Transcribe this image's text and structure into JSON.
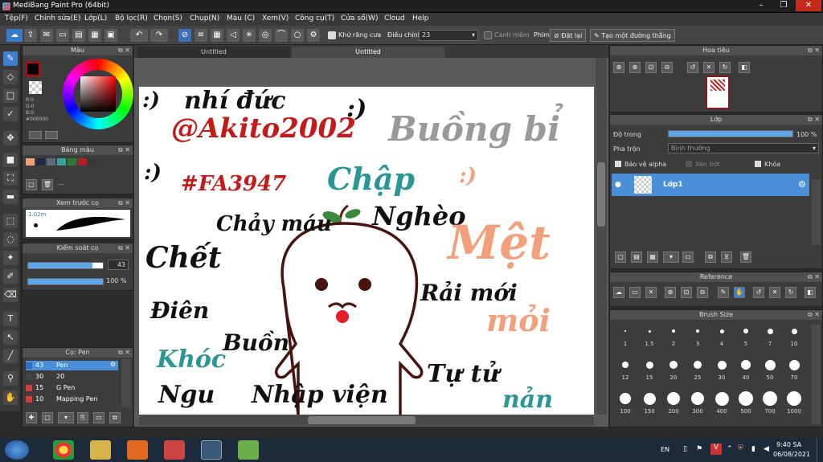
{
  "window": {
    "title": "MediBang Paint Pro (64bit)",
    "min": "–",
    "max": "❐",
    "close": "✕"
  },
  "menu": [
    "Tệp(F)",
    "Chỉnh sửa(E)",
    "Lớp(L)",
    "Bộ lọc(R)",
    "Chọn(S)",
    "Chụp(N)",
    "Màu (C)",
    "Xem(V)",
    "Công cụ(T)",
    "Cửa sổ(W)",
    "Cloud",
    "Help"
  ],
  "toolbar": {
    "antialias_label": "Khử răng cưa",
    "correction_label": "Điều chỉnh",
    "correction_value": "23",
    "canh_mem_label": "Canh mềm",
    "phim_label": "Phim",
    "undo_label": "Đặt lại",
    "straight_label": "Tạo một đường thẳng"
  },
  "tabs": {
    "left": "Untitled",
    "right": "Untitled"
  },
  "color_panel": {
    "title": "Màu",
    "r": "R:0",
    "g": "G:0",
    "b": "B:0",
    "hex": "#000000"
  },
  "palette_panel": {
    "title": "Bảng màu",
    "dash": "---",
    "colors": [
      "#f2a07a",
      "#1e2a4a",
      "#5a6a7a",
      "#3aa0a0",
      "#2c7a3a",
      "#b02020",
      "#383838"
    ]
  },
  "brush_preview": {
    "title": "Xem trước cọ",
    "size": "1.02m"
  },
  "brush_control": {
    "title": "Kiểm soát cọ",
    "size": "43",
    "opacity": "100 %",
    "size_frac": 0.86,
    "opacity_frac": 1.0
  },
  "brush_list": {
    "title": "Cọ: Pen",
    "items": [
      {
        "size": "43",
        "name": "Pen",
        "color": "#2a6fc8"
      },
      {
        "size": "30",
        "name": "20",
        "color": "#444444"
      },
      {
        "size": "15",
        "name": "G Pen",
        "color": "#d83a3a"
      },
      {
        "size": "10",
        "name": "Mapping Pen",
        "color": "#d83a3a"
      }
    ]
  },
  "navigator": {
    "title": "Hoa tiêu"
  },
  "layer_panel": {
    "title": "Lớp",
    "opacity_label": "Độ trong",
    "opacity_value": "100 %",
    "opacity_frac": 1.0,
    "blend_label": "Pha trộn",
    "blend_value": "Bình thường",
    "protect_alpha": "Bảo vệ alpha",
    "clipping": "Xén bớt",
    "lock": "Khóa",
    "layer_name": "Lớp1"
  },
  "reference_panel": {
    "title": "Reference"
  },
  "brush_size_panel": {
    "title": "Brush Size",
    "sizes": [
      "1",
      "1.5",
      "2",
      "3",
      "4",
      "5",
      "7",
      "10",
      "12",
      "15",
      "20",
      "25",
      "30",
      "40",
      "50",
      "70",
      "100",
      "150",
      "200",
      "300",
      "400",
      "500",
      "700",
      "1000"
    ]
  },
  "artwork": {
    "texts": [
      {
        "t": ":)",
        "c": "#111111"
      },
      {
        "t": "nhí đức",
        "c": "#111111"
      },
      {
        "t": "@Akito2002",
        "c": "#c41a1a"
      },
      {
        "t": ":)",
        "c": "#111111"
      },
      {
        "t": "Buồng bỉ",
        "c": "#9a9a9a"
      },
      {
        "t": ":)",
        "c": "#111111"
      },
      {
        "t": "#FA3947",
        "c": "#c41a1a"
      },
      {
        "t": "Chập",
        "c": "#2a9696"
      },
      {
        "t": ":)",
        "c": "#f2a07a"
      },
      {
        "t": "Nghèo",
        "c": "#111111"
      },
      {
        "t": "Chảy máu",
        "c": "#111111"
      },
      {
        "t": "Mệt",
        "c": "#f2a07a"
      },
      {
        "t": "Chết",
        "c": "#111111"
      },
      {
        "t": "Rải mới",
        "c": "#111111"
      },
      {
        "t": "Điên",
        "c": "#111111"
      },
      {
        "t": "mỏi",
        "c": "#f2a07a"
      },
      {
        "t": "Khóc",
        "c": "#2a9696"
      },
      {
        "t": "Buồn",
        "c": "#111111"
      },
      {
        "t": "Tự tử",
        "c": "#111111"
      },
      {
        "t": "Ngu",
        "c": "#111111"
      },
      {
        "t": "Nhập viện",
        "c": "#111111"
      },
      {
        "t": "nản",
        "c": "#2a9696"
      }
    ]
  },
  "taskbar": {
    "lang": "EN",
    "time": "9:40 SA",
    "date": "06/08/2021"
  }
}
